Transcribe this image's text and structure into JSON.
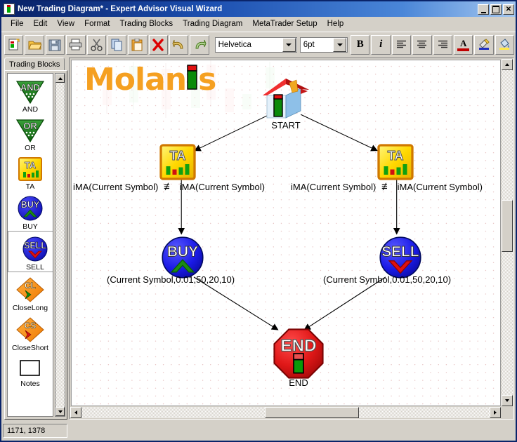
{
  "window": {
    "title": "New Trading Diagram* - Expert Advisor Visual Wizard",
    "icon": "app-candlestick-icon",
    "minimize_label": "_",
    "maximize_label": "□",
    "close_label": "✕"
  },
  "menu": {
    "items": [
      {
        "label": "File"
      },
      {
        "label": "Edit"
      },
      {
        "label": "View"
      },
      {
        "label": "Format"
      },
      {
        "label": "Trading Blocks"
      },
      {
        "label": "Trading Diagram"
      },
      {
        "label": "MetaTrader Setup"
      },
      {
        "label": "Help"
      }
    ]
  },
  "toolbar": {
    "buttons": [
      {
        "name": "new-document-button",
        "icon": "new-document-icon",
        "tooltip": "New"
      },
      {
        "name": "open-folder-button",
        "icon": "open-folder-icon",
        "tooltip": "Open"
      },
      {
        "name": "save-button",
        "icon": "floppy-disk-icon",
        "tooltip": "Save"
      },
      {
        "name": "print-button",
        "icon": "printer-icon",
        "tooltip": "Print"
      },
      {
        "name": "cut-button",
        "icon": "scissors-icon",
        "tooltip": "Cut"
      },
      {
        "name": "copy-button",
        "icon": "copy-pages-icon",
        "tooltip": "Copy"
      },
      {
        "name": "paste-button",
        "icon": "clipboard-icon",
        "tooltip": "Paste"
      },
      {
        "name": "delete-button",
        "icon": "red-x-icon",
        "tooltip": "Delete"
      },
      {
        "name": "undo-button",
        "icon": "undo-arrow-icon",
        "tooltip": "Undo"
      },
      {
        "name": "redo-button",
        "icon": "redo-arrow-icon",
        "tooltip": "Redo"
      }
    ],
    "font_family_value": "Helvetica",
    "font_size_value": "6pt",
    "format_buttons": [
      {
        "name": "bold-button",
        "label": "B",
        "icon": "bold-icon"
      },
      {
        "name": "italic-button",
        "label": "i",
        "icon": "italic-icon"
      },
      {
        "name": "align-left-button",
        "label": "",
        "icon": "align-left-icon"
      },
      {
        "name": "align-center-button",
        "label": "",
        "icon": "align-center-icon"
      },
      {
        "name": "align-right-button",
        "label": "",
        "icon": "align-right-icon"
      },
      {
        "name": "font-color-button",
        "label": "A",
        "icon": "font-color-icon"
      },
      {
        "name": "highlight-button",
        "label": "",
        "icon": "highlighter-icon"
      },
      {
        "name": "fill-color-button",
        "label": "",
        "icon": "paint-bucket-icon"
      }
    ]
  },
  "sidebar": {
    "tab_label": "Trading Blocks",
    "items": [
      {
        "label": "AND",
        "icon": "and-gate-triangle-icon",
        "shape": "green-triangle",
        "text": "AND"
      },
      {
        "label": "OR",
        "icon": "or-gate-triangle-icon",
        "shape": "green-triangle",
        "text": "OR"
      },
      {
        "label": "TA",
        "icon": "technical-analysis-icon",
        "shape": "yellow-square",
        "text": "TA"
      },
      {
        "label": "BUY",
        "icon": "buy-order-icon",
        "shape": "blue-circle",
        "text": "BUY"
      },
      {
        "label": "SELL",
        "icon": "sell-order-icon",
        "shape": "blue-circle",
        "text": "SELL"
      },
      {
        "label": "CloseLong",
        "icon": "close-long-icon",
        "shape": "orange-diamond",
        "text": "CL"
      },
      {
        "label": "CloseShort",
        "icon": "close-short-icon",
        "shape": "orange-diamond",
        "text": "CS"
      },
      {
        "label": "Notes",
        "icon": "notes-rectangle-icon",
        "shape": "white-rect",
        "text": ""
      }
    ]
  },
  "canvas": {
    "logo_text_before": "Molan",
    "logo_text_after": "s",
    "nodes": [
      {
        "id": "start",
        "type": "house",
        "label": "START",
        "icon": "start-house-icon"
      },
      {
        "id": "ta-left",
        "type": "ta",
        "label": "TA",
        "icon": "technical-analysis-icon"
      },
      {
        "id": "ta-right",
        "type": "ta",
        "label": "TA",
        "icon": "technical-analysis-icon"
      },
      {
        "id": "buy",
        "type": "buy",
        "label": "BUY",
        "icon": "buy-order-icon"
      },
      {
        "id": "sell",
        "type": "sell",
        "label": "SELL",
        "icon": "sell-order-icon"
      },
      {
        "id": "end",
        "type": "end",
        "label": "END",
        "icon": "end-stop-sign-icon"
      }
    ],
    "labels": {
      "ta_left_left": "iMA(Current Symbol)",
      "ta_left_op": "≢",
      "ta_left_right": "iMA(Current Symbol)",
      "ta_right_left": "iMA(Current Symbol)",
      "ta_right_op": "≢",
      "ta_right_right": "iMA(Current Symbol)",
      "buy_params": "(Current Symbol,0.01,50,20,10)",
      "sell_params": "(Current Symbol,0.01,50,20,10)",
      "start_caption": "START",
      "end_caption": "END"
    }
  },
  "statusbar": {
    "coordinates": "1171, 1378"
  },
  "colors": {
    "title_start": "#0a246a",
    "title_end": "#a6c8f0",
    "chrome": "#d4d0c8",
    "logo_orange": "#f5a021",
    "buy_blue": "#1a1ae0",
    "sell_blue": "#1a1ae0",
    "end_red": "#e01b1b",
    "ta_yellow": "#ffe000",
    "block_green": "#0f7a10",
    "block_orange": "#f08000"
  }
}
